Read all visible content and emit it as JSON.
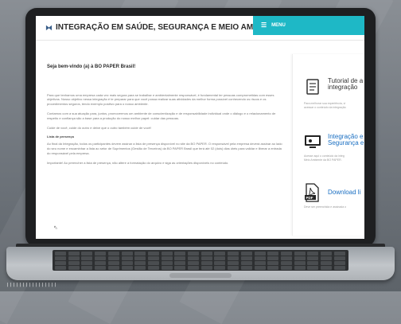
{
  "header": {
    "title": "INTEGRAÇÃO EM SAÚDE, SEGURANÇA E MEIO AMBIENTE",
    "menu_label": "MENU"
  },
  "main": {
    "welcome": "Seja bem-vindo (a) à BO PAPER Brasil!",
    "paragraphs": [
      "Para que tenhamos uma empresa cada vez mais segura para se trabalhar e ambientalmente responsável, é fundamental ter pessoas comprometidas com esses objetivos. Nosso objetivo nessa integração é te preparar para que você possa realizar suas atividades da melhor forma possível conhecendo os riscos e os procedimentos seguros, tendo exemplo positivo para o nosso ambiente.",
      "Contamos com a sua atuação para, juntos, promovermos um ambiente de conscientização e de responsabilidade individual onde o diálogo e o relacionamento de respeito e confiança são a base para a produção do nosso melhor papel: cuidar das pessoas.",
      "Cuide de você, cuide do outro e deixe que o outro também cuide de você!"
    ],
    "subhead": "Lista de presença",
    "paragraphs2": [
      "Ao final da Integração, todos os participantes devem assinar a lista de presença disponível no site da BO PAPER. O responsável pela empresa deverá assinar ao lado do seu nome e encaminhar a lista ao setor de Suprimentos (Gestão de Terceiros) da BO PAPER Brasil que terá até 02 (dois) dias úteis para validar e liberar a entrada do responsável pela empresa.",
      "Importante! Ao preencher a lista de presença, não altere a formatação do arquivo e siga as orientações disponíveis no conteúdo."
    ]
  },
  "sidebar": {
    "cards": [
      {
        "title_line1": "Tutorial de a",
        "title_line2": "integração",
        "desc_line1": "Para melhorar sua experiência, vi",
        "desc_line2": "acessar o conteúdo da integração",
        "icon": "checklist-icon",
        "color": "#333333"
      },
      {
        "title_line1": "Integração e",
        "title_line2": "Segurança e",
        "desc_line1": "Acesse aqui o conteúdo da integ",
        "desc_line2": "Meio Ambiente da BO PAPER.",
        "icon": "monitor-icon",
        "color": "#1a6fc2"
      },
      {
        "title_line1": "Download li",
        "title_line2": "",
        "desc_line1": "Deve ser preenchida e assinada o",
        "desc_line2": "",
        "icon": "pdf-icon",
        "color": "#1a6fc2"
      }
    ]
  },
  "laptop": {
    "barcode": "||||||||||||||||"
  },
  "colors": {
    "accent": "#1eb8c6",
    "link": "#1a6fc2",
    "bezel": "#1e1f21"
  }
}
